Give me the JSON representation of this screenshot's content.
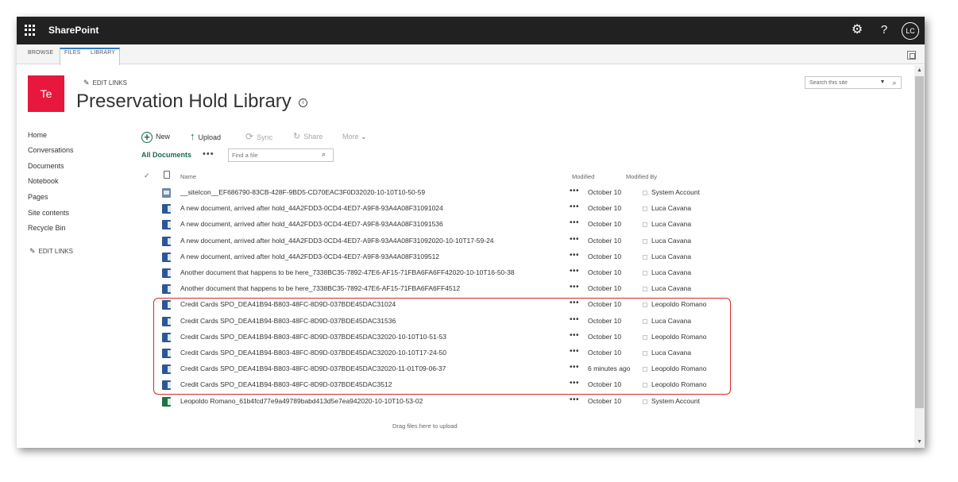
{
  "suite": {
    "brand": "SharePoint",
    "avatar_initials": "LC",
    "help_glyph": "?"
  },
  "ribbon": {
    "tabs": [
      "BROWSE",
      "FILES",
      "LIBRARY"
    ]
  },
  "site": {
    "logo_text": "Te",
    "edit_links": "EDIT LINKS",
    "page_title": "Preservation Hold Library",
    "info_glyph": "i"
  },
  "search": {
    "placeholder": "Search this site"
  },
  "nav": {
    "items": [
      "Home",
      "Conversations",
      "Documents",
      "Notebook",
      "Pages",
      "Site contents",
      "Recycle Bin"
    ],
    "edit_links": "EDIT LINKS"
  },
  "commands": {
    "new": "New",
    "upload": "Upload",
    "sync": "Sync",
    "share": "Share",
    "more": "More"
  },
  "view": {
    "name": "All Documents",
    "ellipsis": "•••",
    "find_placeholder": "Find a file"
  },
  "columns": {
    "name": "Name",
    "modified": "Modified",
    "modified_by": "Modified By"
  },
  "files": [
    {
      "name": "__siteIcon__EF686790-83CB-428F-9BD5-CD70EAC3F0D32020-10-10T10-50-59",
      "icon": "image-file-icon",
      "modified": "October 10",
      "modified_by": "System Account"
    },
    {
      "name": "A new document, arrived after hold_44A2FDD3-0CD4-4ED7-A9F8-93A4A08F31091024",
      "icon": "word-file-icon",
      "modified": "October 10",
      "modified_by": "Luca Cavana"
    },
    {
      "name": "A new document, arrived after hold_44A2FDD3-0CD4-4ED7-A9F8-93A4A08F31091536",
      "icon": "word-file-icon",
      "modified": "October 10",
      "modified_by": "Luca Cavana"
    },
    {
      "name": "A new document, arrived after hold_44A2FDD3-0CD4-4ED7-A9F8-93A4A08F31092020-10-10T17-59-24",
      "icon": "word-file-icon",
      "modified": "October 10",
      "modified_by": "Luca Cavana"
    },
    {
      "name": "A new document, arrived after hold_44A2FDD3-0CD4-4ED7-A9F8-93A4A08F3109512",
      "icon": "word-file-icon",
      "modified": "October 10",
      "modified_by": "Luca Cavana"
    },
    {
      "name": "Another document that happens to be here_7338BC35-7892-47E6-AF15-71FBA6FA6FF42020-10-10T16-50-38",
      "icon": "word-file-icon",
      "modified": "October 10",
      "modified_by": "Luca Cavana"
    },
    {
      "name": "Another document that happens to be here_7338BC35-7892-47E6-AF15-71FBA6FA6FF4512",
      "icon": "word-file-icon",
      "modified": "October 10",
      "modified_by": "Luca Cavana"
    },
    {
      "name": "Credit Cards SPO_DEA41B94-B803-48FC-8D9D-037BDE45DAC31024",
      "icon": "word-file-icon",
      "modified": "October 10",
      "modified_by": "Leopoldo Romano"
    },
    {
      "name": "Credit Cards SPO_DEA41B94-B803-48FC-8D9D-037BDE45DAC31536",
      "icon": "word-file-icon",
      "modified": "October 10",
      "modified_by": "Luca Cavana"
    },
    {
      "name": "Credit Cards SPO_DEA41B94-B803-48FC-8D9D-037BDE45DAC32020-10-10T10-51-53",
      "icon": "word-file-icon",
      "modified": "October 10",
      "modified_by": "Leopoldo Romano"
    },
    {
      "name": "Credit Cards SPO_DEA41B94-B803-48FC-8D9D-037BDE45DAC32020-10-10T17-24-50",
      "icon": "word-file-icon",
      "modified": "October 10",
      "modified_by": "Luca Cavana"
    },
    {
      "name": "Credit Cards SPO_DEA41B94-B803-48FC-8D9D-037BDE45DAC32020-11-01T09-06-37",
      "icon": "word-file-icon",
      "modified": "6 minutes ago",
      "modified_by": "Leopoldo Romano"
    },
    {
      "name": "Credit Cards SPO_DEA41B94-B803-48FC-8D9D-037BDE45DAC3512",
      "icon": "word-file-icon",
      "modified": "October 10",
      "modified_by": "Leopoldo Romano"
    },
    {
      "name": "Leopoldo Romano_61b4fcd77e9a49789babd413d5e7ea942020-10-10T10-53-02",
      "icon": "excel-file-icon",
      "modified": "October 10",
      "modified_by": "System Account"
    }
  ],
  "row_ellipsis": "•••",
  "drag_hint": "Drag files here to upload",
  "colors": {
    "suitebar": "#212121",
    "accent_green": "#1b6b4a",
    "logo_red": "#e8173e",
    "highlight_red": "#d52b2b"
  }
}
